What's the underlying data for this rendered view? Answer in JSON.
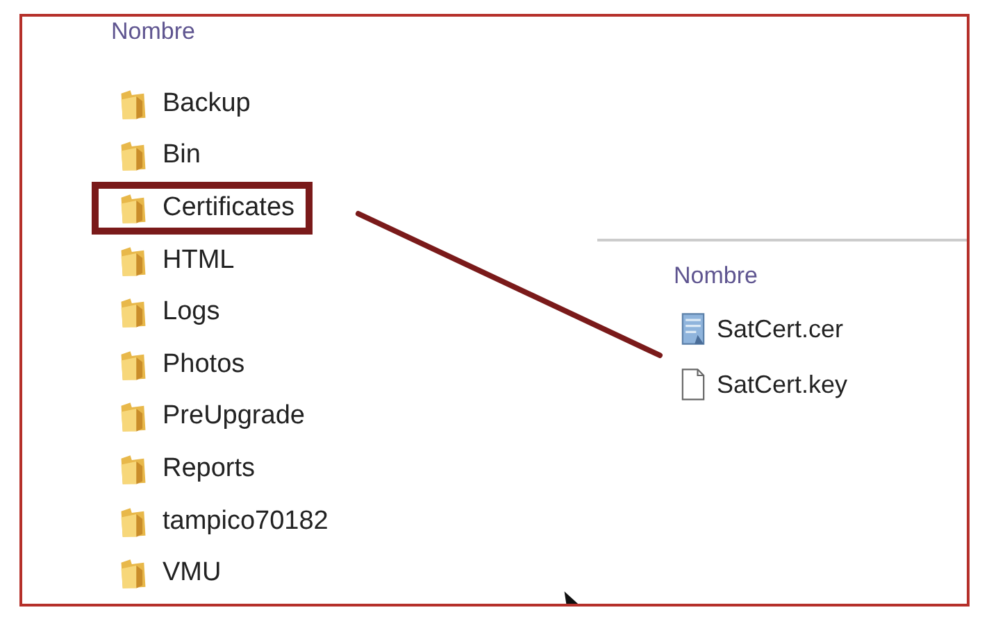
{
  "folders_pane": {
    "column_header": "Nombre",
    "folders": [
      {
        "name": "Backup",
        "highlighted": false
      },
      {
        "name": "Bin",
        "highlighted": false
      },
      {
        "name": "Certificates",
        "highlighted": true
      },
      {
        "name": "HTML",
        "highlighted": false
      },
      {
        "name": "Logs",
        "highlighted": false
      },
      {
        "name": "Photos",
        "highlighted": false
      },
      {
        "name": "PreUpgrade",
        "highlighted": false
      },
      {
        "name": "Reports",
        "highlighted": false
      },
      {
        "name": "tampico70182",
        "highlighted": false
      },
      {
        "name": "VMU",
        "highlighted": false
      }
    ]
  },
  "files_pane": {
    "column_header": "Nombre",
    "files": [
      {
        "name": "SatCert.cer",
        "kind": "certificate"
      },
      {
        "name": "SatCert.key",
        "kind": "file"
      }
    ]
  }
}
